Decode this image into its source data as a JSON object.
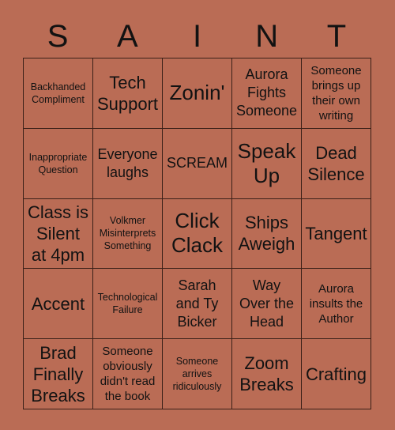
{
  "card": {
    "title_letters": [
      "S",
      "A",
      "I",
      "N",
      "T"
    ],
    "background_color": "#ba6c55",
    "grid_line_color": "#3a2018",
    "text_color": "#121212",
    "rows": 5,
    "columns": 5
  },
  "cells": [
    {
      "text": "Backhanded Compliment",
      "size": "fs-xs"
    },
    {
      "text": "Tech Support",
      "size": "fs-l"
    },
    {
      "text": "Zonin'",
      "size": "fs-xl"
    },
    {
      "text": "Aurora Fights Someone",
      "size": "fs-m"
    },
    {
      "text": "Someone brings up their own writing",
      "size": "fs-s"
    },
    {
      "text": "Inappropriate Question",
      "size": "fs-xs"
    },
    {
      "text": "Everyone laughs",
      "size": "fs-m"
    },
    {
      "text": "SCREAM",
      "size": "fs-m"
    },
    {
      "text": "Speak Up",
      "size": "fs-xl"
    },
    {
      "text": "Dead Silence",
      "size": "fs-l"
    },
    {
      "text": "Class is Silent at 4pm",
      "size": "fs-l"
    },
    {
      "text": "Volkmer Misinterprets Something",
      "size": "fs-xs"
    },
    {
      "text": "Click Clack",
      "size": "fs-xl"
    },
    {
      "text": "Ships Aweigh",
      "size": "fs-l"
    },
    {
      "text": "Tangent",
      "size": "fs-l"
    },
    {
      "text": "Accent",
      "size": "fs-l"
    },
    {
      "text": "Technological Failure",
      "size": "fs-xs"
    },
    {
      "text": "Sarah and Ty Bicker",
      "size": "fs-m"
    },
    {
      "text": "Way Over the Head",
      "size": "fs-m"
    },
    {
      "text": "Aurora insults the Author",
      "size": "fs-s"
    },
    {
      "text": "Brad Finally Breaks",
      "size": "fs-l"
    },
    {
      "text": "Someone obviously didn't read the book",
      "size": "fs-s"
    },
    {
      "text": "Someone arrives ridiculously",
      "size": "fs-xs"
    },
    {
      "text": "Zoom Breaks",
      "size": "fs-l"
    },
    {
      "text": "Crafting",
      "size": "fs-l"
    }
  ]
}
